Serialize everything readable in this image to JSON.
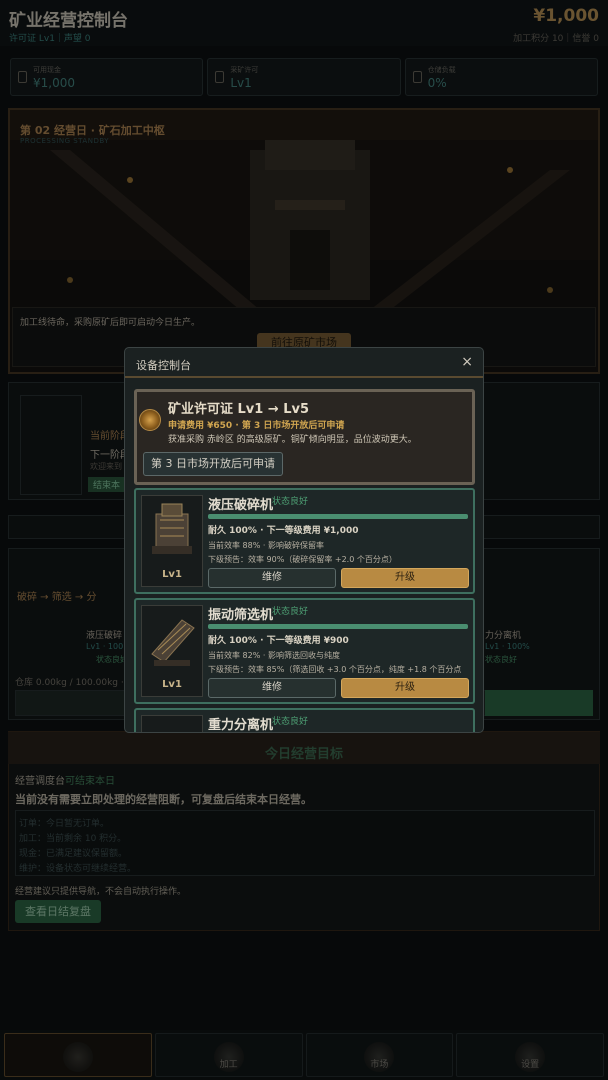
{
  "header": {
    "title": "矿业经营控制台",
    "subline": "许可证 Lv1｜声望 0",
    "money": "¥1,000",
    "subline_right": "加工积分 10｜信誉 0"
  },
  "stats": [
    {
      "label": "可用现金",
      "value": "¥1,000"
    },
    {
      "label": "采矿许可",
      "value": "Lv1"
    },
    {
      "label": "仓储负载",
      "value": "0%"
    }
  ],
  "scene": {
    "title": "第 02 经营日 · 矿石加工中枢",
    "subtitle": "PROCESSING STANDBY",
    "text": "加工线待命，采购原矿后即可启动今日生产。",
    "button": "前往原矿市场"
  },
  "background": {
    "lane_1": "当前阶段",
    "lane_2": "下一阶段",
    "lane_3": "欢迎来到",
    "lane_4": "结束本",
    "chain": "破碎 → 筛选 → 分",
    "machine_left": "液压破碎",
    "machine_left_sub": "Lv1 · 100",
    "machine_left_status": "状态良好",
    "machine_right": "力分离机",
    "machine_right_sub": "Lv1 · 100%",
    "machine_right_status": "状态良好",
    "storage": "仓库 0.00kg / 100.00kg ·"
  },
  "goal": {
    "title": "今日经营目标",
    "line1_prefix": "经营调度台",
    "line1_ok": "可结束本日",
    "line2": "当前没有需要立即处理的经营阻断，可复盘后结束本日经营。",
    "items": [
      "订单：今日暂无订单。",
      "加工：当前剩余 10 积分。",
      "现金：已满足建议保留额。",
      "维护：设备状态可继续经营。"
    ],
    "note": "经营建议只提供导航，不会自动执行操作。",
    "button": "查看日结复盘"
  },
  "nav": [
    {
      "label": "",
      "icon": "gear-cluster-icon",
      "active": true
    },
    {
      "label": "加工",
      "icon": "machine-icon"
    },
    {
      "label": "市场",
      "icon": "market-icon"
    },
    {
      "label": "设置",
      "icon": "settings-icon"
    }
  ],
  "modal": {
    "title": "设备控制台",
    "close": "×",
    "license": {
      "title": "矿业许可证 Lv1 → Lv5",
      "cost": "申请费用 ¥650 · 第 3 日市场开放后可申请",
      "desc": "获准采购 赤岭区 的高级原矿。铜矿倾向明显，品位波动更大。",
      "button": "第 3 日市场开放后可申请"
    },
    "cards": [
      {
        "name": "液压破碎机",
        "status": "状态良好",
        "durability_fraction": 1.0,
        "line1": "耐久 100% · 下一等级费用 ¥1,000",
        "line2": "当前效率 88% · 影响破碎保留率",
        "line3": "下级预告：效率 90%（破碎保留率 +2.0 个百分点）",
        "level": "Lv1",
        "repair": "维修",
        "upgrade": "升级"
      },
      {
        "name": "振动筛选机",
        "status": "状态良好",
        "durability_fraction": 1.0,
        "line1": "耐久 100% · 下一等级费用 ¥900",
        "line2": "当前效率 82% · 影响筛选回收与纯度",
        "line3": "下级预告：效率 85%（筛选回收 +3.0 个百分点，纯度 +1.8 个百分点",
        "level": "Lv1",
        "repair": "维修",
        "upgrade": "升级"
      },
      {
        "name": "重力分离机",
        "status": "状态良好"
      }
    ]
  },
  "colors": {
    "accent_gold": "#b88a42",
    "accent_green": "#4a8e70",
    "teal_text": "#478b86"
  }
}
